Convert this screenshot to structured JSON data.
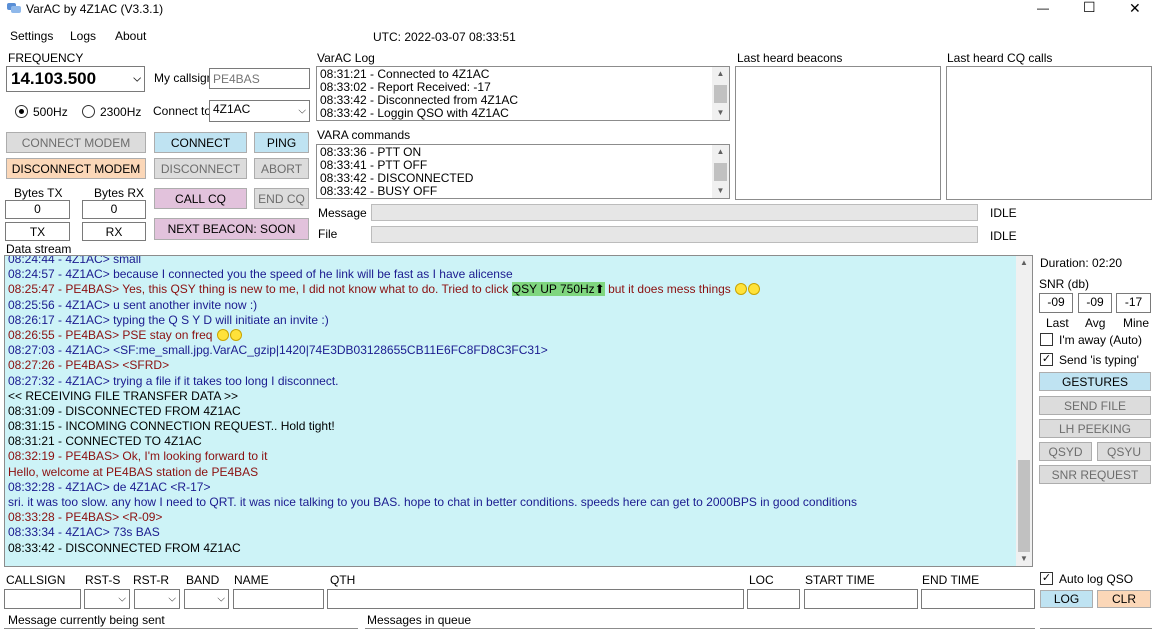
{
  "window": {
    "title": "VarAC by 4Z1AC (V3.3.1)",
    "minimize": "—",
    "maximize": "☐",
    "close": "✕"
  },
  "menu": {
    "settings": "Settings",
    "logs": "Logs",
    "about": "About"
  },
  "utc": "UTC: 2022-03-07 08:33:51",
  "frequency": {
    "label": "FREQUENCY",
    "value": "14.103.500",
    "bw_500": "500Hz",
    "bw_2300": "2300Hz",
    "selected_bw": "500Hz"
  },
  "callsign": {
    "label": "My callsign",
    "placeholder": "PE4BAS"
  },
  "connect_to": {
    "label": "Connect to",
    "value": "4Z1AC"
  },
  "buttons": {
    "connect_modem": "CONNECT MODEM",
    "disconnect_modem": "DISCONNECT MODEM",
    "connect": "CONNECT",
    "ping": "PING",
    "disconnect": "DISCONNECT",
    "abort": "ABORT",
    "call_cq": "CALL CQ",
    "end_cq": "END CQ",
    "next_beacon": "NEXT BEACON: SOON",
    "tx": "TX",
    "rx": "RX",
    "gestures": "GESTURES",
    "send_file": "SEND FILE",
    "lh_peeking": "LH PEEKING",
    "qsyd": "QSYD",
    "qsyu": "QSYU",
    "snr_request": "SNR REQUEST",
    "log": "LOG",
    "clr": "CLR"
  },
  "bytes": {
    "tx_label": "Bytes TX",
    "rx_label": "Bytes RX",
    "tx_value": "0",
    "rx_value": "0"
  },
  "varac_log": {
    "label": "VarAC Log",
    "lines": [
      "08:31:21 - Connected to 4Z1AC",
      "08:33:02 - Report Received: -17",
      "08:33:42 - Disconnected from 4Z1AC",
      "08:33:42 - Loggin QSO with 4Z1AC"
    ]
  },
  "vara_commands": {
    "label": "VARA commands",
    "lines": [
      "08:33:36 - PTT ON",
      "08:33:41 - PTT OFF",
      "08:33:42 - DISCONNECTED",
      "08:33:42 - BUSY OFF"
    ]
  },
  "beacons": {
    "label": "Last heard beacons"
  },
  "cq_calls": {
    "label": "Last heard CQ calls"
  },
  "message": {
    "label": "Message",
    "status": "IDLE"
  },
  "file": {
    "label": "File",
    "status": "IDLE"
  },
  "data_stream": {
    "label": "Data stream",
    "lines": [
      {
        "t": "08:24:44 - 4Z1AC> small",
        "c": "blue"
      },
      {
        "t": "08:24:57 - 4Z1AC> because I connected you the speed of he link will be fast as I have alicense",
        "c": "blue"
      },
      {
        "t": "08:25:47 - PE4BAS> Yes, this QSY thing is new to me, I did not know what to do. Tried to click ",
        "c": "red",
        "hl": "QSY UP 750Hz⬆",
        "after": " but it does mess things ",
        "emoji": 2
      },
      {
        "t": "08:25:56 - 4Z1AC> u sent another invite now :)",
        "c": "blue"
      },
      {
        "t": "08:26:17 - 4Z1AC> typing the Q S Y D will initiate an invite :)",
        "c": "blue"
      },
      {
        "t": "08:26:55 - PE4BAS> PSE stay on freq ",
        "c": "red",
        "emoji": 2
      },
      {
        "t": "08:27:03 - 4Z1AC> <SF:me_small.jpg.VarAC_gzip|1420|74E3DB03128655CB11E6FC8FD8C3FC31>",
        "c": "blue"
      },
      {
        "t": "08:27:26 - PE4BAS> <SFRD>",
        "c": "red"
      },
      {
        "t": "08:27:32 - 4Z1AC> trying a file if it takes too long I disconnect.",
        "c": "blue"
      },
      {
        "t": "<< RECEIVING FILE TRANSFER DATA >>",
        "c": "black"
      },
      {
        "t": "08:31:09 - DISCONNECTED FROM 4Z1AC",
        "c": "black"
      },
      {
        "t": "08:31:15 - INCOMING CONNECTION REQUEST.. Hold tight!",
        "c": "black"
      },
      {
        "t": "08:31:21 - CONNECTED TO 4Z1AC",
        "c": "black"
      },
      {
        "t": "08:32:19 - PE4BAS> Ok, I'm looking forward to it",
        "c": "red"
      },
      {
        "t": "Hello, welcome at PE4BAS station de PE4BAS",
        "c": "red"
      },
      {
        "t": "08:32:28 - 4Z1AC> de 4Z1AC <R-17>",
        "c": "blue"
      },
      {
        "t": "sri. it was too slow. any how I need to QRT. it was nice talking to you BAS. hope to chat in better conditions. speeds here can get to 2000BPS in good conditions",
        "c": "blue"
      },
      {
        "t": "08:33:28 - PE4BAS> <R-09>",
        "c": "red"
      },
      {
        "t": "08:33:34 - 4Z1AC> 73s BAS",
        "c": "blue"
      },
      {
        "t": "08:33:42 - DISCONNECTED FROM 4Z1AC",
        "c": "black"
      }
    ]
  },
  "right_panel": {
    "duration": "Duration: 02:20",
    "snr_label": "SNR (db)",
    "snr_last": "-09",
    "snr_avg": "-09",
    "snr_mine": "-17",
    "last_label": "Last",
    "avg_label": "Avg",
    "mine_label": "Mine",
    "away_label": "I'm away (Auto)",
    "away_checked": false,
    "typing_label": "Send 'is typing'",
    "typing_checked": true,
    "autolog_label": "Auto log QSO",
    "autolog_checked": true
  },
  "qso_fields": {
    "callsign": "CALLSIGN",
    "rst_s": "RST-S",
    "rst_r": "RST-R",
    "band": "BAND",
    "name": "NAME",
    "qth": "QTH",
    "loc": "LOC",
    "start_time": "START TIME",
    "end_time": "END TIME"
  },
  "bottom": {
    "current_msg": "Message currently being sent",
    "queue": "Messages in queue"
  }
}
